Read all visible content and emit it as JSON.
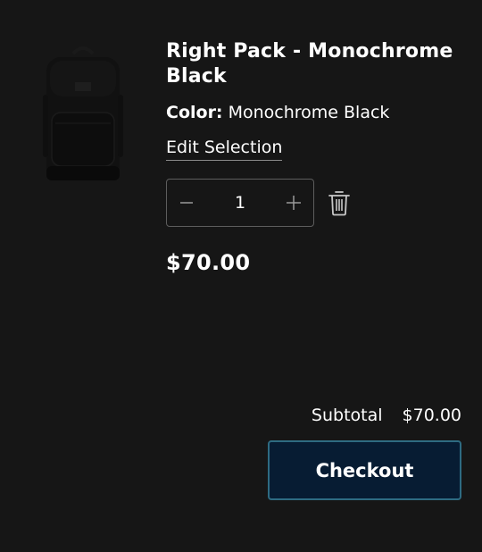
{
  "product": {
    "title": "Right Pack - Monochrome Black",
    "color_label": "Color:",
    "color_value": "Monochrome Black",
    "edit_link": "Edit Selection",
    "image_icon": "backpack-image",
    "price": "$70.00"
  },
  "quantity": {
    "value": "1",
    "decrease_icon": "minus-icon",
    "increase_icon": "plus-icon"
  },
  "remove": {
    "icon": "trash-icon"
  },
  "summary": {
    "subtotal_label": "Subtotal",
    "subtotal_value": "$70.00"
  },
  "checkout": {
    "label": "Checkout"
  },
  "colors": {
    "background": "#161616",
    "checkout_bg": "#071c33",
    "checkout_border": "#2e6b82"
  }
}
